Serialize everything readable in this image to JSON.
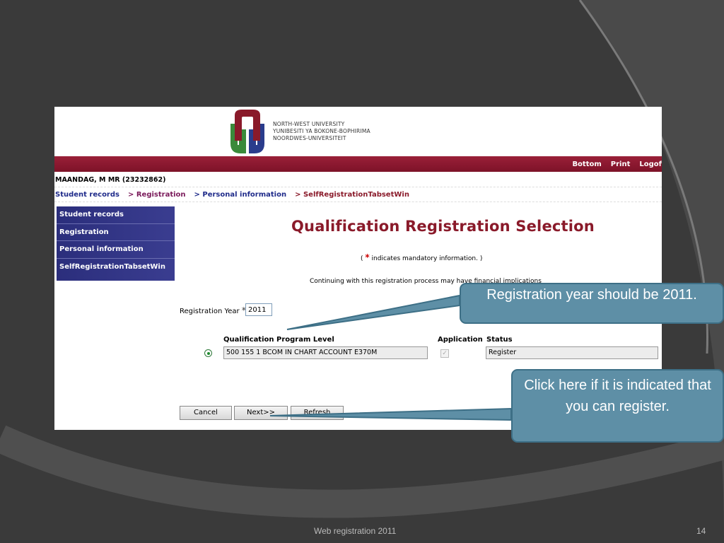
{
  "logo": {
    "lines": [
      "NORTH-WEST UNIVERSITY",
      "YUNIBESITI YA BOKONE-BOPHIRIMA",
      "NOORDWES-UNIVERSITEIT"
    ]
  },
  "topbar": {
    "bottom": "Bottom",
    "print": "Print",
    "logoff": "Logof"
  },
  "user": "MAANDAG, M MR (23232862)",
  "breadcrumb": {
    "student_records": "Student records",
    "registration": "> Registration",
    "personal_information": "> Personal information",
    "tabset": "> SelfRegistrationTabsetWin"
  },
  "sidenav": [
    "Student records",
    "Registration",
    "Personal information",
    "SelfRegistrationTabsetWin"
  ],
  "page_title": "Qualification Registration Selection",
  "mandatory": {
    "open": "(",
    "star": "*",
    "text": "indicates mandatory information. )"
  },
  "warning": "Continuing with this registration process may have financial implications",
  "registration_year": {
    "label": "Registration Year",
    "star": "*",
    "value": "2011"
  },
  "table": {
    "headers": {
      "program": "Qualification Program Level",
      "application": "Application",
      "status": "Status"
    },
    "row": {
      "program": "500 155 1 BCOM IN CHART ACCOUNT E370M",
      "application_check": "✓",
      "status": "Register"
    }
  },
  "buttons": {
    "cancel": "Cancel",
    "next": "Next>>",
    "refresh": "Refresh"
  },
  "callouts": {
    "registration_year": "Registration year should be 2011.",
    "next": "Click here if it is indicated that you can register."
  },
  "footer": {
    "title": "Web registration 2011",
    "page": "14"
  },
  "colors": {
    "accent": "#8a1a2a",
    "nav": "#2b2e7c",
    "callout": "#5e8fa6"
  }
}
